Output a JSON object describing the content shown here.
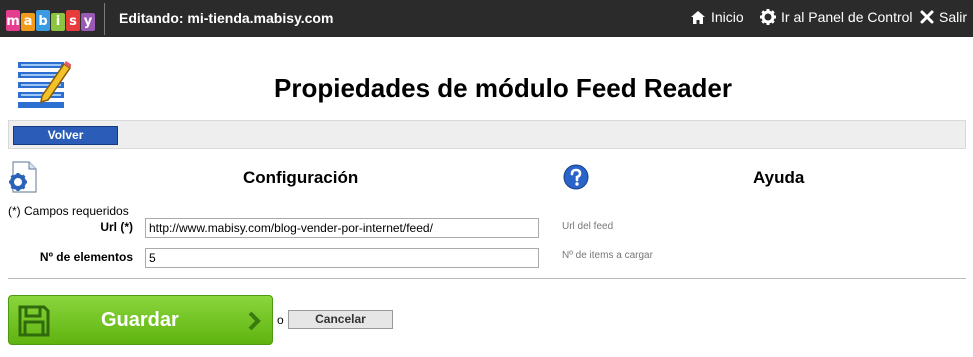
{
  "header": {
    "logo_letters": [
      "m",
      "a",
      "b",
      "i",
      "s",
      "y"
    ],
    "logo_colors": [
      "#e63c8e",
      "#f49a1b",
      "#3a9be0",
      "#8bc53f",
      "#e63c3c",
      "#9b59b6"
    ],
    "editing_label": "Editando: mi-tienda.mabisy.com",
    "nav": {
      "home": "Inicio",
      "control_panel": "Ir al Panel de Control",
      "exit": "Salir"
    }
  },
  "page_title": "Propiedades de módulo Feed Reader",
  "back_button": "Volver",
  "sections": {
    "config": "Configuración",
    "help": "Ayuda"
  },
  "form": {
    "required_note": "(*) Campos requeridos",
    "url": {
      "label": "Url (*)",
      "value": "http://www.mabisy.com/blog-vender-por-internet/feed/",
      "hint": "Url del feed"
    },
    "items": {
      "label": "Nº de elementos",
      "value": "5",
      "hint": "Nº de items a cargar"
    }
  },
  "actions": {
    "save": "Guardar",
    "or": "o",
    "cancel": "Cancelar"
  },
  "colors": {
    "topbar": "#2b2b2b",
    "primary_button": "#2a5cb8",
    "save_button": "#6cbf1f"
  }
}
